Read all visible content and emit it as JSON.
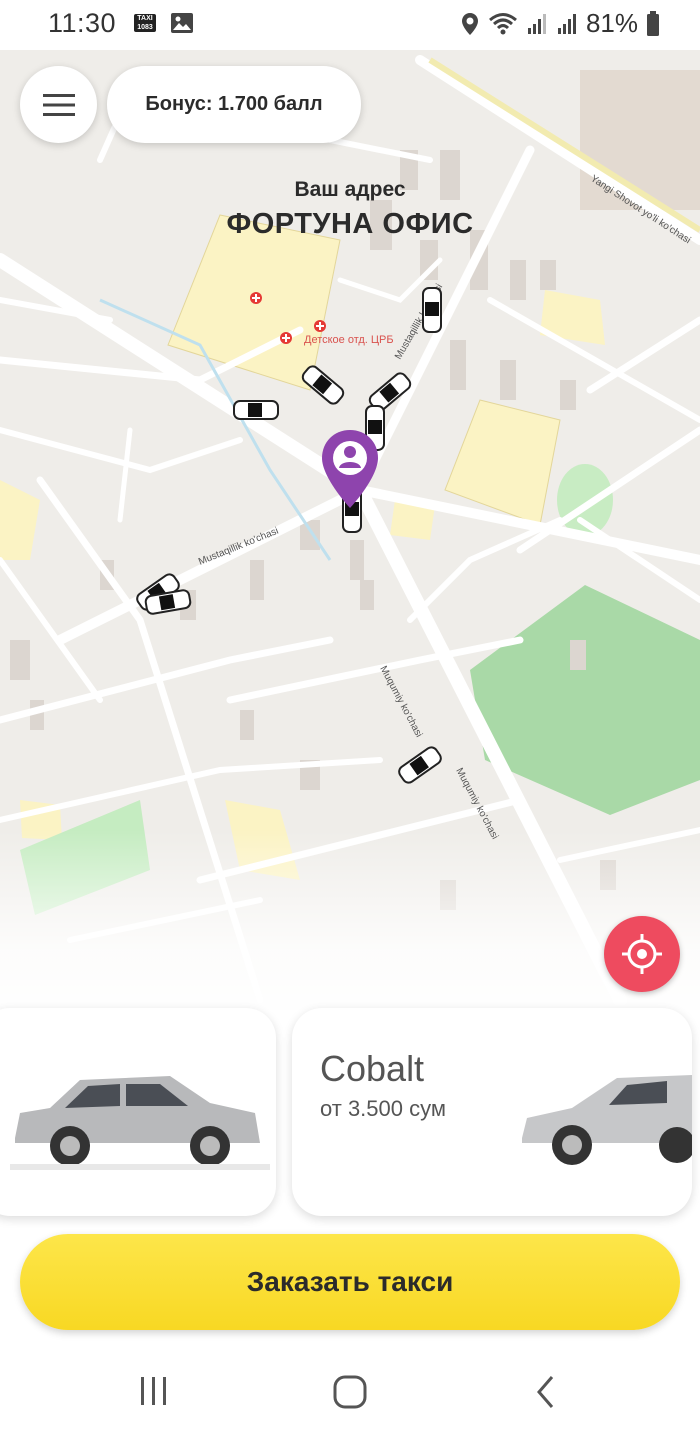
{
  "status_bar": {
    "time": "11:30",
    "taxi_icon_text": "TAXI 1083",
    "battery_percent": "81%",
    "icons": [
      "taxi-app-icon",
      "gallery-icon",
      "location-icon",
      "wifi-icon",
      "signal-icon",
      "signal-icon",
      "battery-icon"
    ]
  },
  "header": {
    "menu_icon": "hamburger-menu-icon",
    "bonus_text": "Бонус: 1.700 балл"
  },
  "address": {
    "caption": "Ваш адрес",
    "title": "ФОРТУНА ОФИС"
  },
  "map": {
    "labels": {
      "clinic": "Детское отд. ЦРБ",
      "street_1": "Yangi Shovot yo'li ko'chasi",
      "street_2": "Mustaqillik ko'chasi",
      "street_3": "Mustaqillik ko'chasi",
      "street_4": "Muqumiy ko'chasi",
      "street_5": "Muqumiy ko'chasi"
    },
    "pin_icon": "user-location-pin-icon",
    "locate_icon": "crosshair-locate-icon"
  },
  "cars": [
    {
      "name": "",
      "price": ""
    },
    {
      "name": "Cobalt",
      "price": "от 3.500 сум"
    }
  ],
  "order_button": "Заказать такси",
  "nav": {
    "icons": [
      "recent-apps-icon",
      "home-icon",
      "back-icon"
    ]
  }
}
